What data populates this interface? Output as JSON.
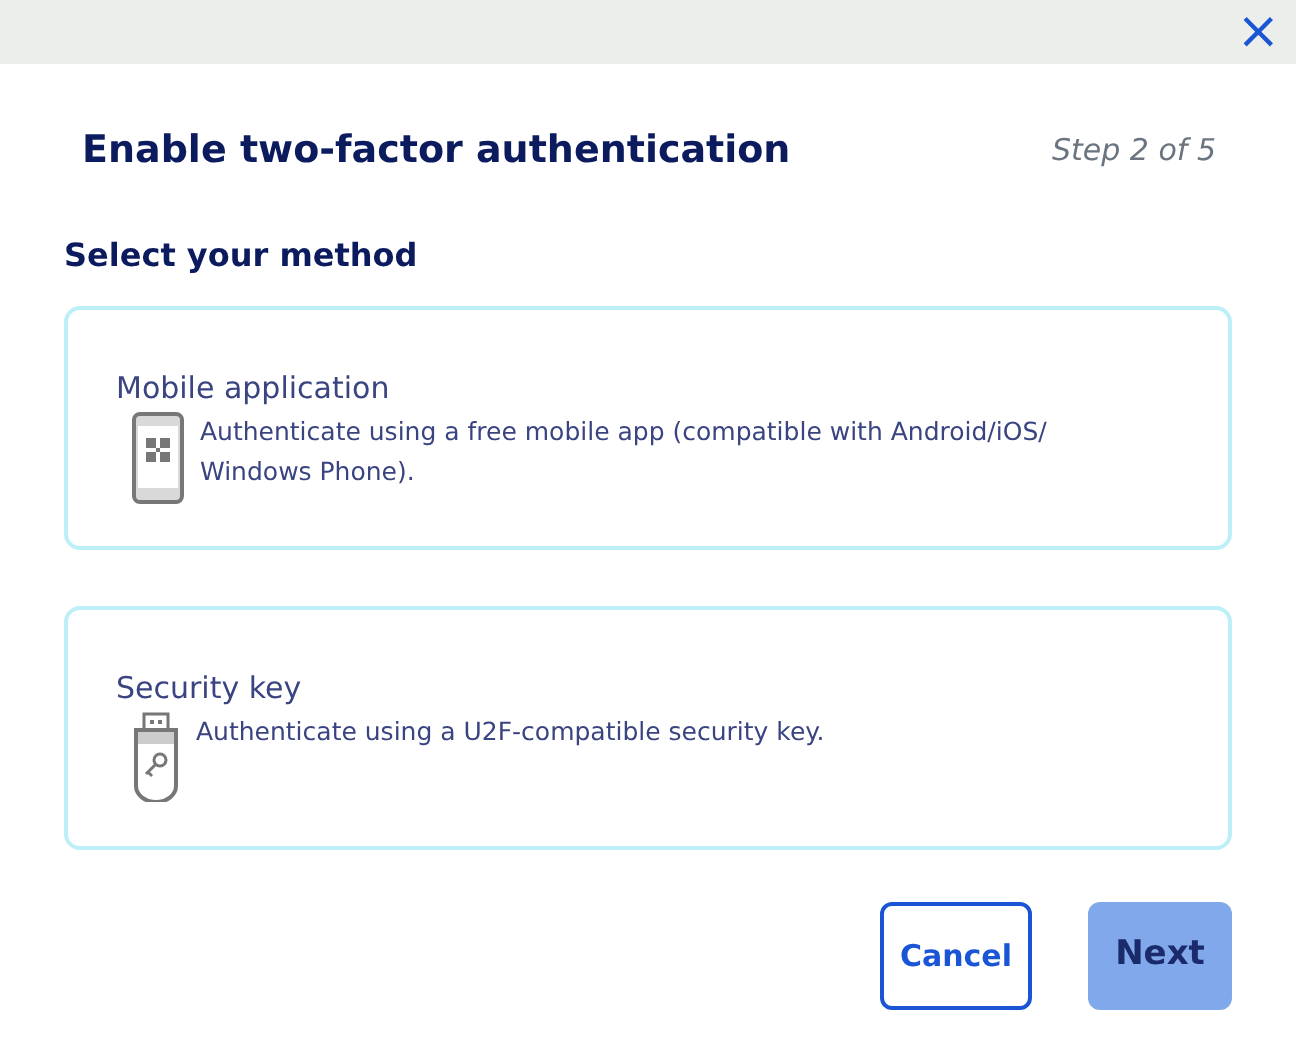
{
  "close_label": "×",
  "title": "Enable two-factor authentication",
  "step": "Step 2 of 5",
  "section_title": "Select your method",
  "options": [
    {
      "kind": "mobile",
      "title": "Mobile application",
      "description": "Authenticate using a free mobile app (compatible with Android/iOS/ Windows Phone).",
      "selected": false
    },
    {
      "kind": "key",
      "title": "Security key",
      "description": "Authenticate using a U2F-compatible security key.",
      "selected": false
    }
  ],
  "buttons": [
    {
      "label": "Cancel",
      "kind": "secondary",
      "disabled": false
    },
    {
      "label": "Next",
      "kind": "primary",
      "disabled": true
    }
  ]
}
